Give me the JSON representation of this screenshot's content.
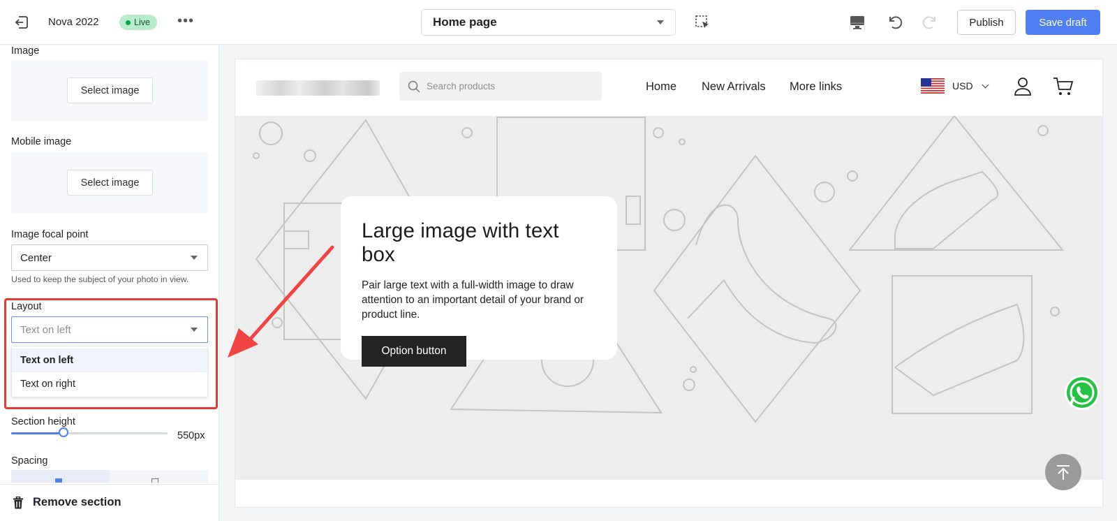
{
  "topbar": {
    "store_name": "Nova 2022",
    "status": "Live",
    "page_selector": "Home page",
    "publish_label": "Publish",
    "save_label": "Save draft"
  },
  "sidebar": {
    "image_label": "Image",
    "select_image_label": "Select image",
    "mobile_image_label": "Mobile image",
    "focal_point_label": "Image focal point",
    "focal_point_value": "Center",
    "focal_point_help": "Used to keep the subject of your photo in view.",
    "layout_label": "Layout",
    "layout_placeholder": "Text on left",
    "layout_options": [
      "Text on left",
      "Text on right"
    ],
    "section_height_label": "Section height",
    "section_height_value": "550px",
    "section_height_fraction": 0.33,
    "spacing_label": "Spacing",
    "remove_label": "Remove section"
  },
  "preview": {
    "search_placeholder": "Search products",
    "nav": [
      "Home",
      "New Arrivals",
      "More links"
    ],
    "currency": "USD",
    "hero_title": "Large image with text box",
    "hero_text": "Pair large text with a full-width image to draw attention to an important detail of your brand or product line.",
    "hero_button": "Option button"
  },
  "colors": {
    "accent": "#4f7ff0",
    "live_badge": "#b7ebc9",
    "highlight": "#e53935"
  }
}
